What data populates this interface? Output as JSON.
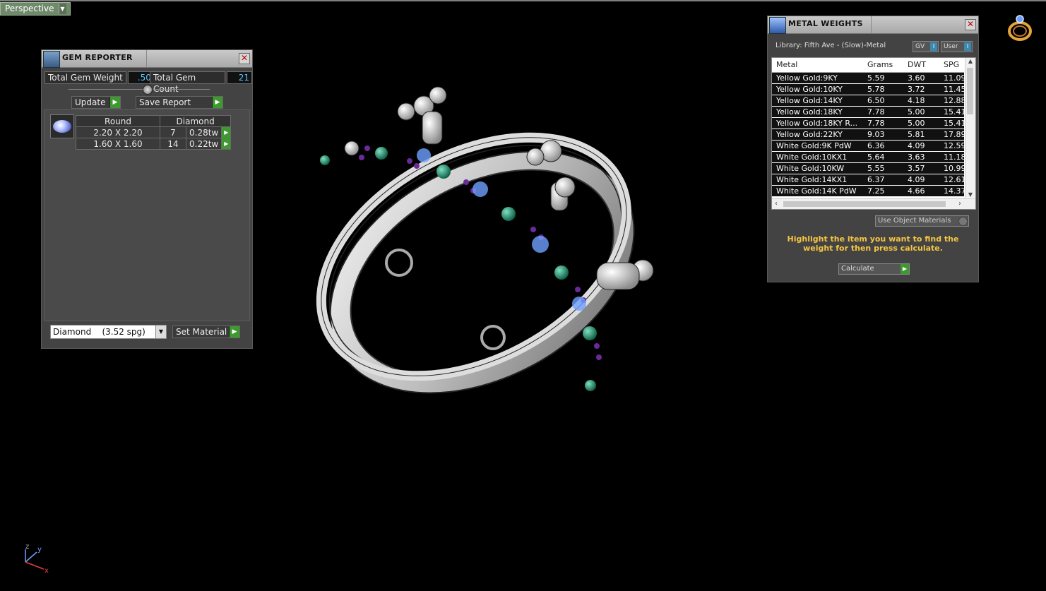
{
  "viewport": {
    "label": "Perspective",
    "dropdown_icon": "chevron-down-icon"
  },
  "gem_reporter": {
    "title": "GEM REPORTER",
    "total_weight_label": "Total Gem Weight",
    "total_weight_value": ".50",
    "total_count_label": "Total Gem Count",
    "total_count_value": "21",
    "update_label": "Update",
    "save_report_label": "Save Report",
    "table": {
      "shape": "Round",
      "material": "Diamond",
      "rows": [
        {
          "size": "2.20 X 2.20",
          "count": "7",
          "weight": "0.28tw"
        },
        {
          "size": "1.60 X 1.60",
          "count": "14",
          "weight": "0.22tw"
        }
      ]
    },
    "material_select": "Diamond    (3.52 spg)",
    "set_material_label": "Set Material"
  },
  "metal_weights": {
    "title": "METAL WEIGHTS",
    "library": "Library: Fifth Ave - (Slow)-Metal",
    "gv_label": "GV",
    "user_label": "User",
    "columns": [
      "Metal",
      "Grams",
      "DWT",
      "SPG"
    ],
    "rows": [
      {
        "metal": "Yellow Gold:9KY",
        "grams": "5.59",
        "dwt": "3.60",
        "spg": "11.09"
      },
      {
        "metal": "Yellow Gold:10KY",
        "grams": "5.78",
        "dwt": "3.72",
        "spg": "11.45"
      },
      {
        "metal": "Yellow Gold:14KY",
        "grams": "6.50",
        "dwt": "4.18",
        "spg": "12.88"
      },
      {
        "metal": "Yellow Gold:18KY",
        "grams": "7.78",
        "dwt": "5.00",
        "spg": "15.41"
      },
      {
        "metal": "Yellow Gold:18KY R...",
        "grams": "7.78",
        "dwt": "5.00",
        "spg": "15.41"
      },
      {
        "metal": "Yellow Gold:22KY",
        "grams": "9.03",
        "dwt": "5.81",
        "spg": "17.89"
      },
      {
        "metal": "White Gold:9K PdW",
        "grams": "6.36",
        "dwt": "4.09",
        "spg": "12.59"
      },
      {
        "metal": "White Gold:10KX1",
        "grams": "5.64",
        "dwt": "3.63",
        "spg": "11.18"
      },
      {
        "metal": "White Gold:10KW",
        "grams": "5.55",
        "dwt": "3.57",
        "spg": "10.99"
      },
      {
        "metal": "White Gold:14KX1",
        "grams": "6.37",
        "dwt": "4.09",
        "spg": "12.61"
      },
      {
        "metal": "White Gold:14K PdW",
        "grams": "7.25",
        "dwt": "4.66",
        "spg": "14.37"
      }
    ],
    "use_object_materials_label": "Use Object Materials",
    "hint": "Highlight the item you want to find the weight for then press calculate.",
    "calculate_label": "Calculate"
  },
  "axis": {
    "z": "z",
    "y": "y",
    "x": "x"
  },
  "colors": {
    "accent_green": "#3e9a2e",
    "hint_yellow": "#f5c542",
    "value_blue": "#59c4ff"
  }
}
